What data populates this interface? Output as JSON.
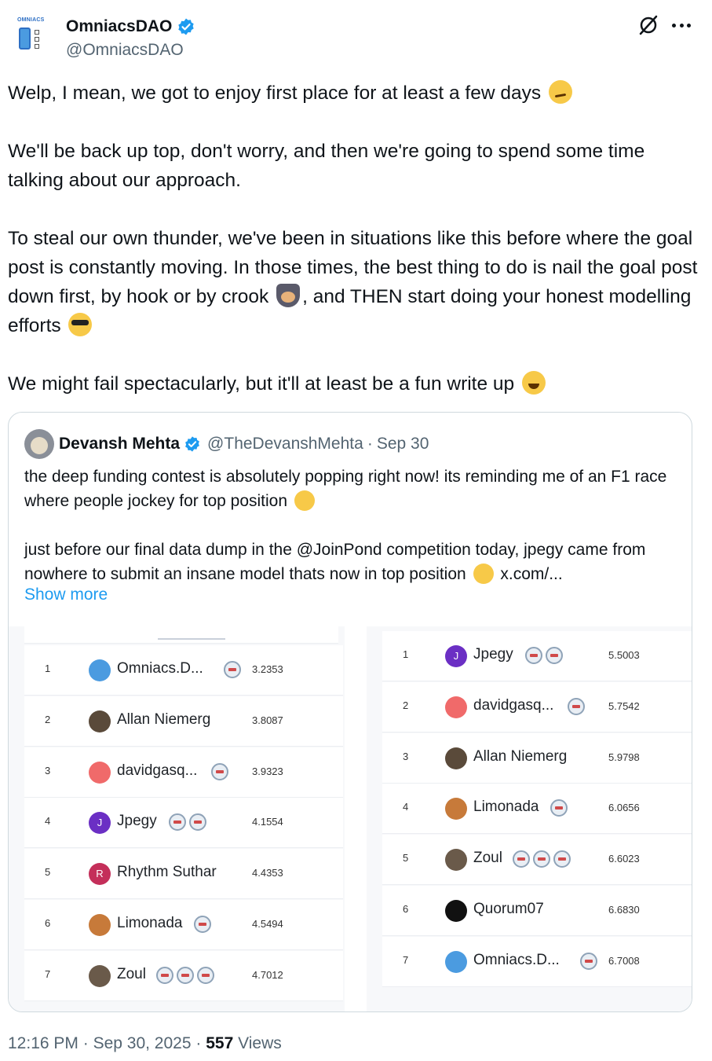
{
  "author": {
    "display_name": "OmniacsDAO",
    "handle": "@OmniacsDAO",
    "avatar_text": "OMNIACS"
  },
  "tweet": {
    "paragraphs": [
      [
        "Welp, I mean, we got to enjoy first place for at least a few days",
        "smirk-emoji"
      ],
      [
        "We'll be back up top, don't worry, and then we're going to spend some time talking about our approach."
      ],
      [
        "To steal our own thunder, we've been in situations like this before where the goal post is constantly moving. In those times, the best thing to do is nail the goal post down first, by hook or by crook",
        "spy-emoji",
        ", and THEN start doing your honest modelling efforts",
        "sunglasses-emoji"
      ],
      [
        "We might fail spectacularly, but it'll at least be a fun write up",
        "grin-emoji"
      ]
    ]
  },
  "quote": {
    "display_name": "Devansh Mehta",
    "handle": "@TheDevanshMehta",
    "separator": "·",
    "date": "Sep 30",
    "p1": "the deep funding contest is absolutely popping right now! its reminding me of an F1 race where people jockey for top position",
    "p2a": "just before our final data dump in the @JoinPond  competition today, jpegy came from nowhere to submit an insane model thats now in top position",
    "p2b": " x.com/...",
    "show_more": "Show more"
  },
  "leaderboard_left": [
    {
      "rank": "1",
      "name": "Omniacs.D...",
      "score": "3.2353",
      "badges": 1,
      "avatar": "",
      "color": "#4b9be0"
    },
    {
      "rank": "2",
      "name": "Allan Niemerg",
      "score": "3.8087",
      "badges": 0,
      "avatar": "",
      "color": "#5a4a3a"
    },
    {
      "rank": "3",
      "name": "davidgasq...",
      "score": "3.9323",
      "badges": 1,
      "avatar": "",
      "color": "#f06a6a"
    },
    {
      "rank": "4",
      "name": "Jpegy",
      "score": "4.1554",
      "badges": 2,
      "avatar": "J",
      "color": "#6b2fc4"
    },
    {
      "rank": "5",
      "name": "Rhythm Suthar",
      "score": "4.4353",
      "badges": 0,
      "avatar": "R",
      "color": "#c42f5a"
    },
    {
      "rank": "6",
      "name": "Limonada",
      "score": "4.5494",
      "badges": 1,
      "avatar": "",
      "color": "#c77a3a"
    },
    {
      "rank": "7",
      "name": "Zoul",
      "score": "4.7012",
      "badges": 3,
      "avatar": "",
      "color": "#6a5a4a"
    }
  ],
  "leaderboard_right": [
    {
      "rank": "1",
      "name": "Jpegy",
      "score": "5.5003",
      "badges": 2,
      "avatar": "J",
      "color": "#6b2fc4"
    },
    {
      "rank": "2",
      "name": "davidgasq...",
      "score": "5.7542",
      "badges": 1,
      "avatar": "",
      "color": "#f06a6a"
    },
    {
      "rank": "3",
      "name": "Allan Niemerg",
      "score": "5.9798",
      "badges": 0,
      "avatar": "",
      "color": "#5a4a3a"
    },
    {
      "rank": "4",
      "name": "Limonada",
      "score": "6.0656",
      "badges": 1,
      "avatar": "",
      "color": "#c77a3a"
    },
    {
      "rank": "5",
      "name": "Zoul",
      "score": "6.6023",
      "badges": 3,
      "avatar": "",
      "color": "#6a5a4a"
    },
    {
      "rank": "6",
      "name": "Quorum07",
      "score": "6.6830",
      "badges": 0,
      "avatar": "",
      "color": "#111111"
    },
    {
      "rank": "7",
      "name": "Omniacs.D...",
      "score": "6.7008",
      "badges": 1,
      "avatar": "",
      "color": "#4b9be0"
    }
  ],
  "footer": {
    "time": "12:16 PM",
    "sep": "·",
    "date": "Sep 30, 2025",
    "views_count": "557",
    "views_label": "Views"
  },
  "colors": {
    "accent": "#1d9bf0",
    "secondary_text": "#536471",
    "border": "#cfd9de"
  }
}
